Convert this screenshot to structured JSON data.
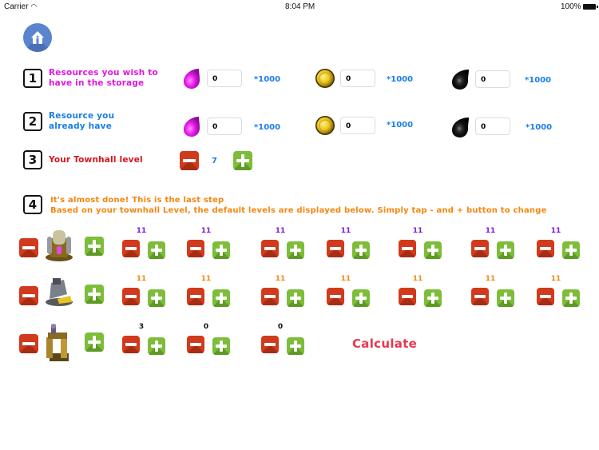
{
  "status_bar": {
    "carrier": "Carrier",
    "time": "8:04 PM",
    "battery": "100%"
  },
  "home_button": {
    "icon": "home-icon"
  },
  "colors": {
    "accent_blue": "#1a7ee8",
    "pink": "#e018e0",
    "red": "#d8141e",
    "orange": "#f4860e",
    "minus": "#d23a1d",
    "plus": "#7dbd3a",
    "calculate": "#e8384e"
  },
  "step1": {
    "number": "1",
    "label_line1": "Resources you wish to",
    "label_line2": "have in the storage",
    "resources": [
      {
        "icon": "elixir-icon",
        "value": "0",
        "multiplier": "*1000"
      },
      {
        "icon": "gold-icon",
        "value": "0",
        "multiplier": "*1000"
      },
      {
        "icon": "dark-elixir-icon",
        "value": "0",
        "multiplier": "*1000"
      }
    ]
  },
  "step2": {
    "number": "2",
    "label_line1": "Resource you",
    "label_line2": "already have",
    "resources": [
      {
        "icon": "elixir-icon",
        "value": "0",
        "multiplier": "*1000"
      },
      {
        "icon": "gold-icon",
        "value": "0",
        "multiplier": "*1000"
      },
      {
        "icon": "dark-elixir-icon",
        "value": "0",
        "multiplier": "*1000"
      }
    ]
  },
  "step3": {
    "number": "3",
    "label": "Your Townhall level",
    "townhall_level": "7"
  },
  "step4": {
    "number": "4",
    "line1": "It's almost done! This is the last step",
    "line2": "Based on your townhall Level, the default levels are displayed below. Simply tap - and + button to change"
  },
  "collectors": [
    {
      "name": "elixir-collector",
      "levels": [
        "11",
        "11",
        "11",
        "11",
        "11",
        "11",
        "11"
      ]
    },
    {
      "name": "gold-mine",
      "levels": [
        "11",
        "11",
        "11",
        "11",
        "11",
        "11",
        "11"
      ]
    },
    {
      "name": "dark-elixir-drill",
      "levels": [
        "3",
        "0",
        "0"
      ]
    }
  ],
  "calculate_label": "Calculate"
}
